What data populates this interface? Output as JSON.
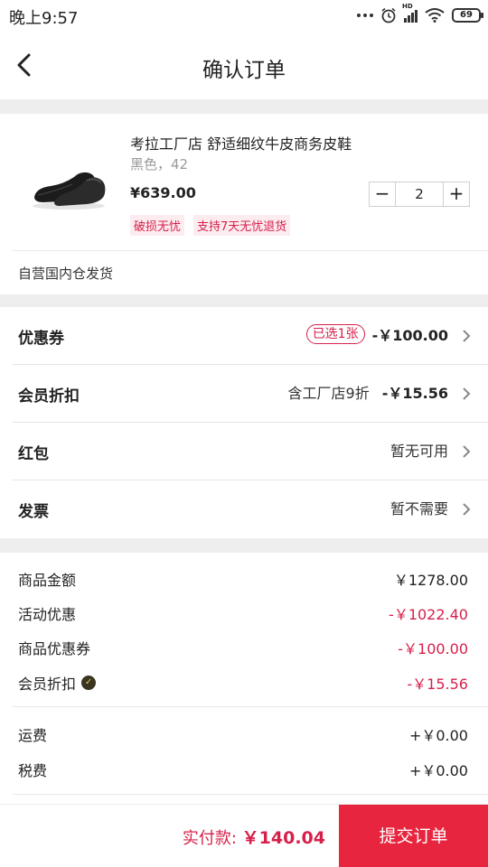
{
  "status_bar": {
    "time": "晚上9:57",
    "battery": "69",
    "network_label": "HD"
  },
  "header": {
    "title": "确认订单"
  },
  "product": {
    "name": "考拉工厂店 舒适细纹牛皮商务皮鞋",
    "spec": "黑色，42",
    "price": "¥639.00",
    "quantity": "2",
    "tags": [
      "破损无忧",
      "支持7天无忧退货"
    ],
    "shipping_note": "自营国内仓发货"
  },
  "options": {
    "coupon": {
      "label": "优惠券",
      "badge": "已选1张",
      "amount": "-￥100.00"
    },
    "member": {
      "label": "会员折扣",
      "note": "含工厂店9折",
      "amount": "-￥15.56"
    },
    "redpack": {
      "label": "红包",
      "value": "暂无可用"
    },
    "invoice": {
      "label": "发票",
      "value": "暂不需要"
    }
  },
  "summary": {
    "goods_amount": {
      "label": "商品金额",
      "value": "￥1278.00"
    },
    "activity": {
      "label": "活动优惠",
      "value": "-￥1022.40"
    },
    "goods_coupon": {
      "label": "商品优惠券",
      "value": "-￥100.00"
    },
    "member_discount": {
      "label": "会员折扣",
      "value": "-￥15.56"
    },
    "freight": {
      "label": "运费",
      "value": "+￥0.00"
    },
    "tax": {
      "label": "税费",
      "value": "+￥0.00"
    }
  },
  "footer": {
    "pay_label": "实付款:",
    "pay_amount": "￥140.04",
    "submit_label": "提交订单"
  },
  "colors": {
    "accent_red": "#e8253e",
    "price_red": "#d6204b",
    "gap_gray": "#eeeeee"
  }
}
